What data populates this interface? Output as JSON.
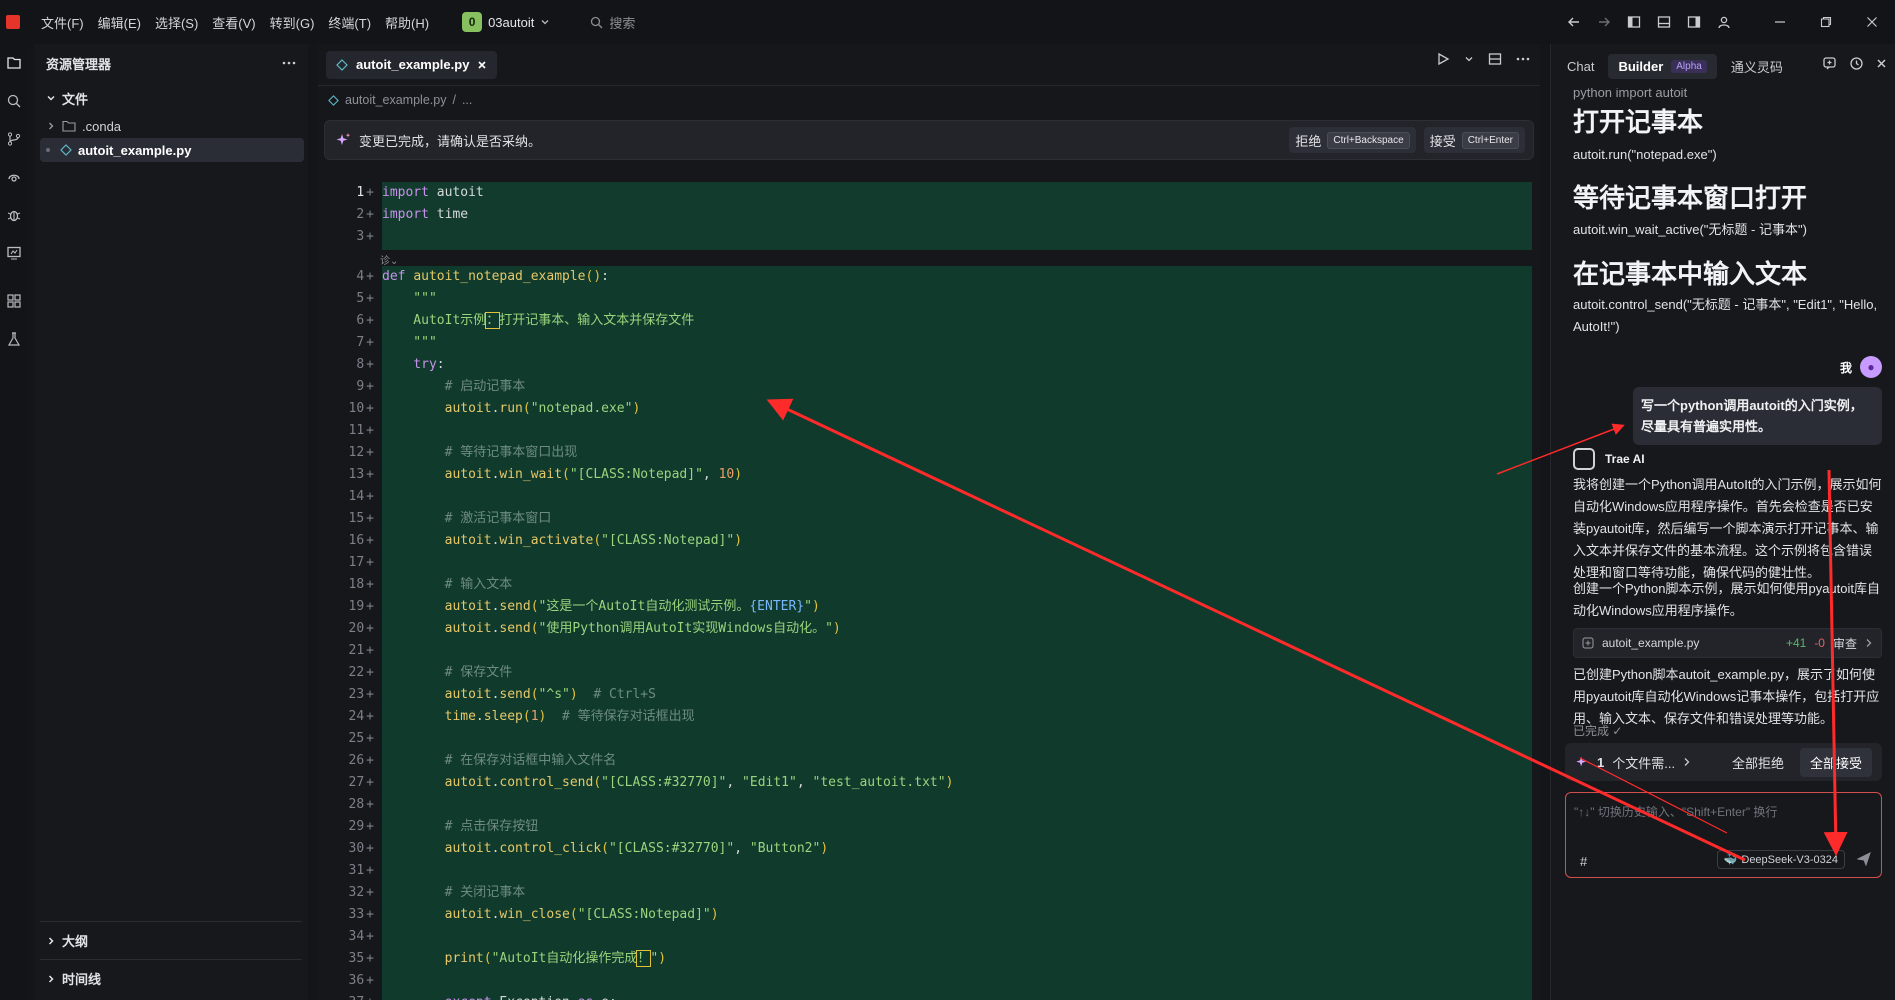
{
  "menu": [
    "文件(F)",
    "编辑(E)",
    "选择(S)",
    "查看(V)",
    "转到(G)",
    "终端(T)",
    "帮助(H)"
  ],
  "project": {
    "badge": "0",
    "name": "03autoit"
  },
  "search": {
    "placeholder": "搜索"
  },
  "sidebar": {
    "title": "资源管理器",
    "section": "文件",
    "items": [
      {
        "label": ".conda"
      },
      {
        "label": "autoit_example.py"
      }
    ],
    "outline": "大纲",
    "timeline": "时间线"
  },
  "editor": {
    "tab": "autoit_example.py",
    "breadcrumb": "autoit_example.py",
    "breadcrumb_more": "...",
    "banner": {
      "message": "变更已完成，请确认是否采纳。",
      "reject": "拒绝",
      "reject_kbd": "Ctrl+Backspace",
      "accept": "接受",
      "accept_kbd": "Ctrl+Enter"
    },
    "line_numbers": [
      "1",
      "2",
      "3",
      "4",
      "5",
      "6",
      "7",
      "8",
      "9",
      "10",
      "11",
      "12",
      "13",
      "14",
      "15",
      "16",
      "17",
      "18",
      "19",
      "20",
      "21",
      "22",
      "23",
      "24",
      "25",
      "26",
      "27",
      "28",
      "29",
      "30",
      "31",
      "32",
      "33",
      "34",
      "35",
      "36",
      "37"
    ],
    "fold_label": "诊"
  },
  "right": {
    "tabs": {
      "chat": "Chat",
      "builder": "Builder",
      "alpha": "Alpha",
      "lingma": "通义灵码"
    },
    "partial_top": "python import autoit",
    "h1": "打开记事本",
    "p1": "autoit.run(\"notepad.exe\")",
    "h2": "等待记事本窗口打开",
    "p2": "autoit.win_wait_active(\"无标题 - 记事本\")",
    "h3": "在记事本中输入文本",
    "p3": "autoit.control_send(\"无标题 - 记事本\", \"Edit1\", \"Hello, AutoIt!\")",
    "me": "我",
    "user_msg": "写一个python调用autoit的入门实例，尽量具有普遍实用性。",
    "ai_name": "Trae AI",
    "ai_p1": "我将创建一个Python调用AutoIt的入门示例，展示如何自动化Windows应用程序操作。首先会检查是否已安装pyautoit库，然后编写一个脚本演示打开记事本、输入文本并保存文件的基本流程。这个示例将包含错误处理和窗口等待功能，确保代码的健壮性。",
    "ai_p2": "创建一个Python脚本示例，展示如何使用pyautoit库自动化Windows应用程序操作。",
    "file_card": {
      "name": "autoit_example.py",
      "added": "+41",
      "removed": "-0",
      "review": "审查"
    },
    "ai_p3": "已创建Python脚本autoit_example.py，展示了如何使用pyautoit库自动化Windows记事本操作，包括打开应用、输入文本、保存文件和错误处理等功能。",
    "done": "已完成",
    "footer": {
      "count": "1",
      "label": "个文件需...",
      "reject_all": "全部拒绝",
      "accept_all": "全部接受"
    },
    "input": {
      "placeholder": "\"↑↓\" 切换历史输入、\"Shift+Enter\" 换行",
      "hash": "#",
      "model": "DeepSeek-V3-0324"
    }
  },
  "colors": {
    "accent_red": "#e5342a",
    "diff_bg": "#123b2e",
    "annotation": "#ff2a2a"
  }
}
